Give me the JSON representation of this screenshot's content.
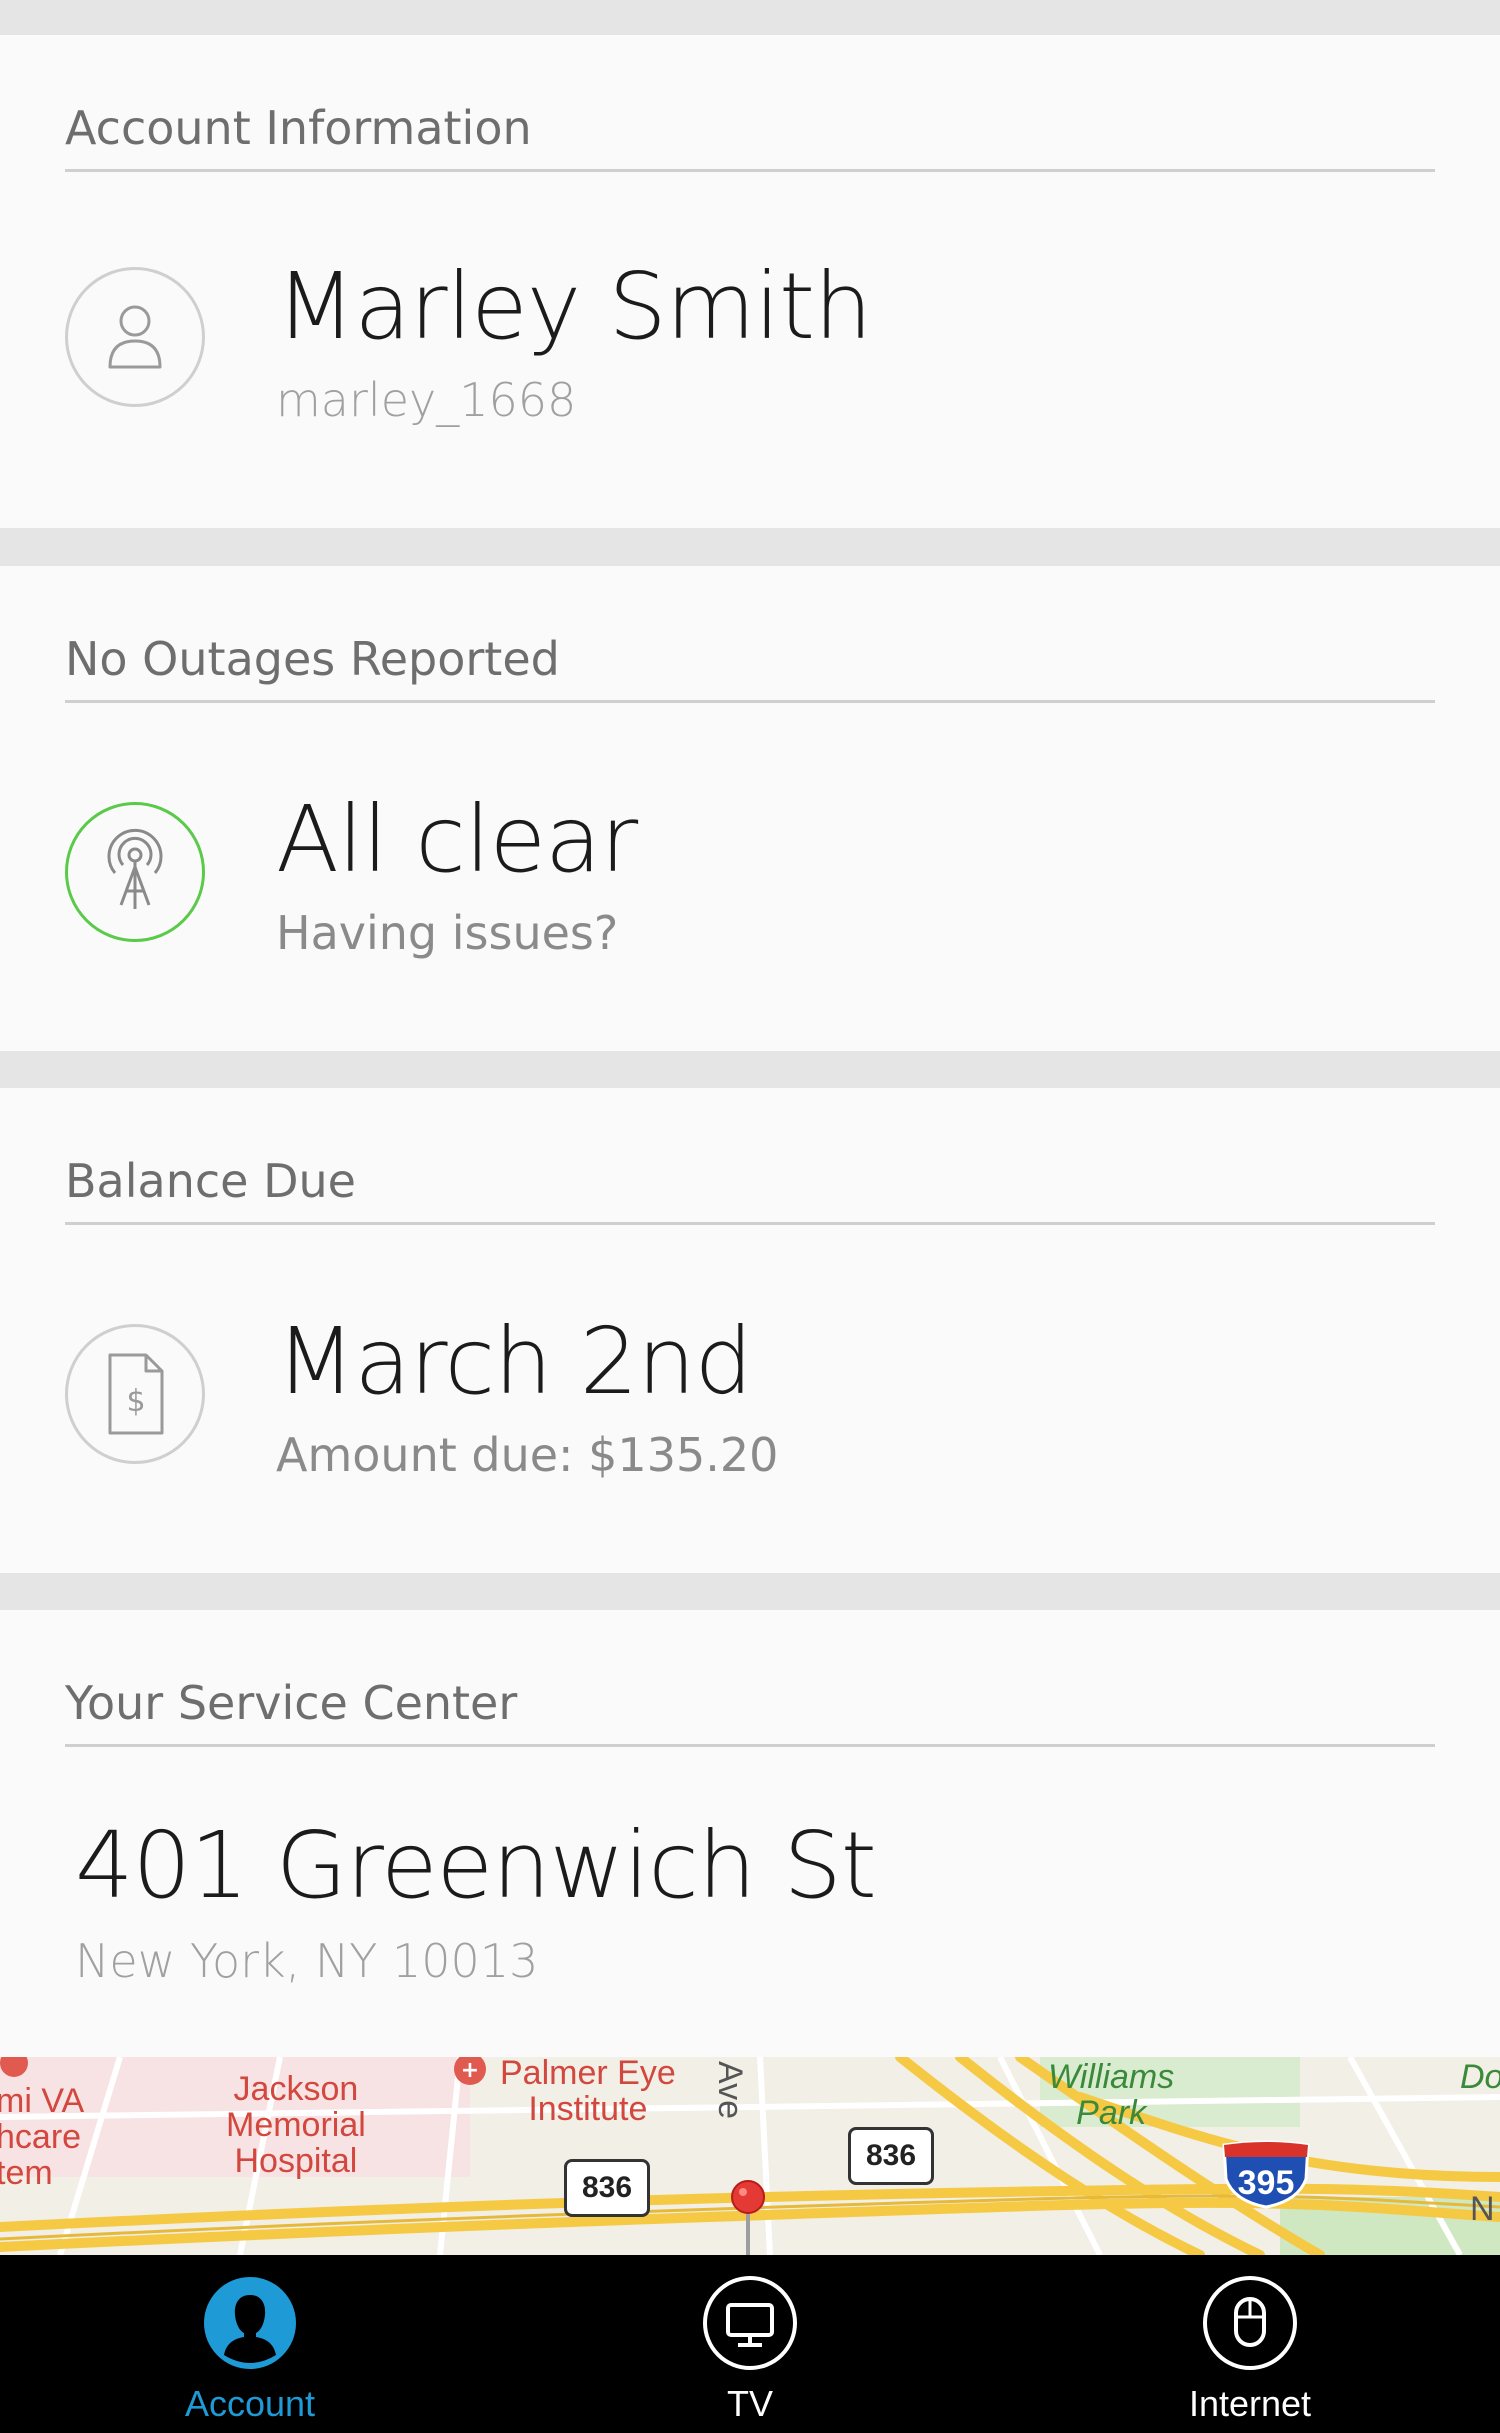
{
  "account": {
    "header": "Account Information",
    "name": "Marley Smith",
    "username": "marley_1668",
    "icon": "user-icon"
  },
  "outages": {
    "header": "No Outages Reported",
    "status": "All clear",
    "link": "Having issues?",
    "icon": "antenna-icon",
    "status_color": "#5bc94a"
  },
  "balance": {
    "header": "Balance Due",
    "due_date": "March 2nd",
    "amount": "Amount due: $135.20",
    "icon": "bill-icon"
  },
  "service_center": {
    "header": "Your Service Center",
    "street": "401 Greenwich St",
    "city": "New York, NY 10013"
  },
  "map": {
    "labels": [
      "mi VA\nhcare\ntem",
      "Jackson\nMemorial\nHospital",
      "Palmer Eye\nInstitute",
      "Ave",
      "Williams\nPark",
      "Do",
      "N"
    ],
    "route_shields": [
      "836",
      "836"
    ],
    "interstate": "395",
    "pin_color": "#e53935"
  },
  "tabbar": {
    "tabs": [
      {
        "label": "Account",
        "icon": "person-icon",
        "active": true
      },
      {
        "label": "TV",
        "icon": "tv-icon",
        "active": false
      },
      {
        "label": "Internet",
        "icon": "mouse-icon",
        "active": false
      }
    ],
    "active_color": "#1e9ad6"
  }
}
